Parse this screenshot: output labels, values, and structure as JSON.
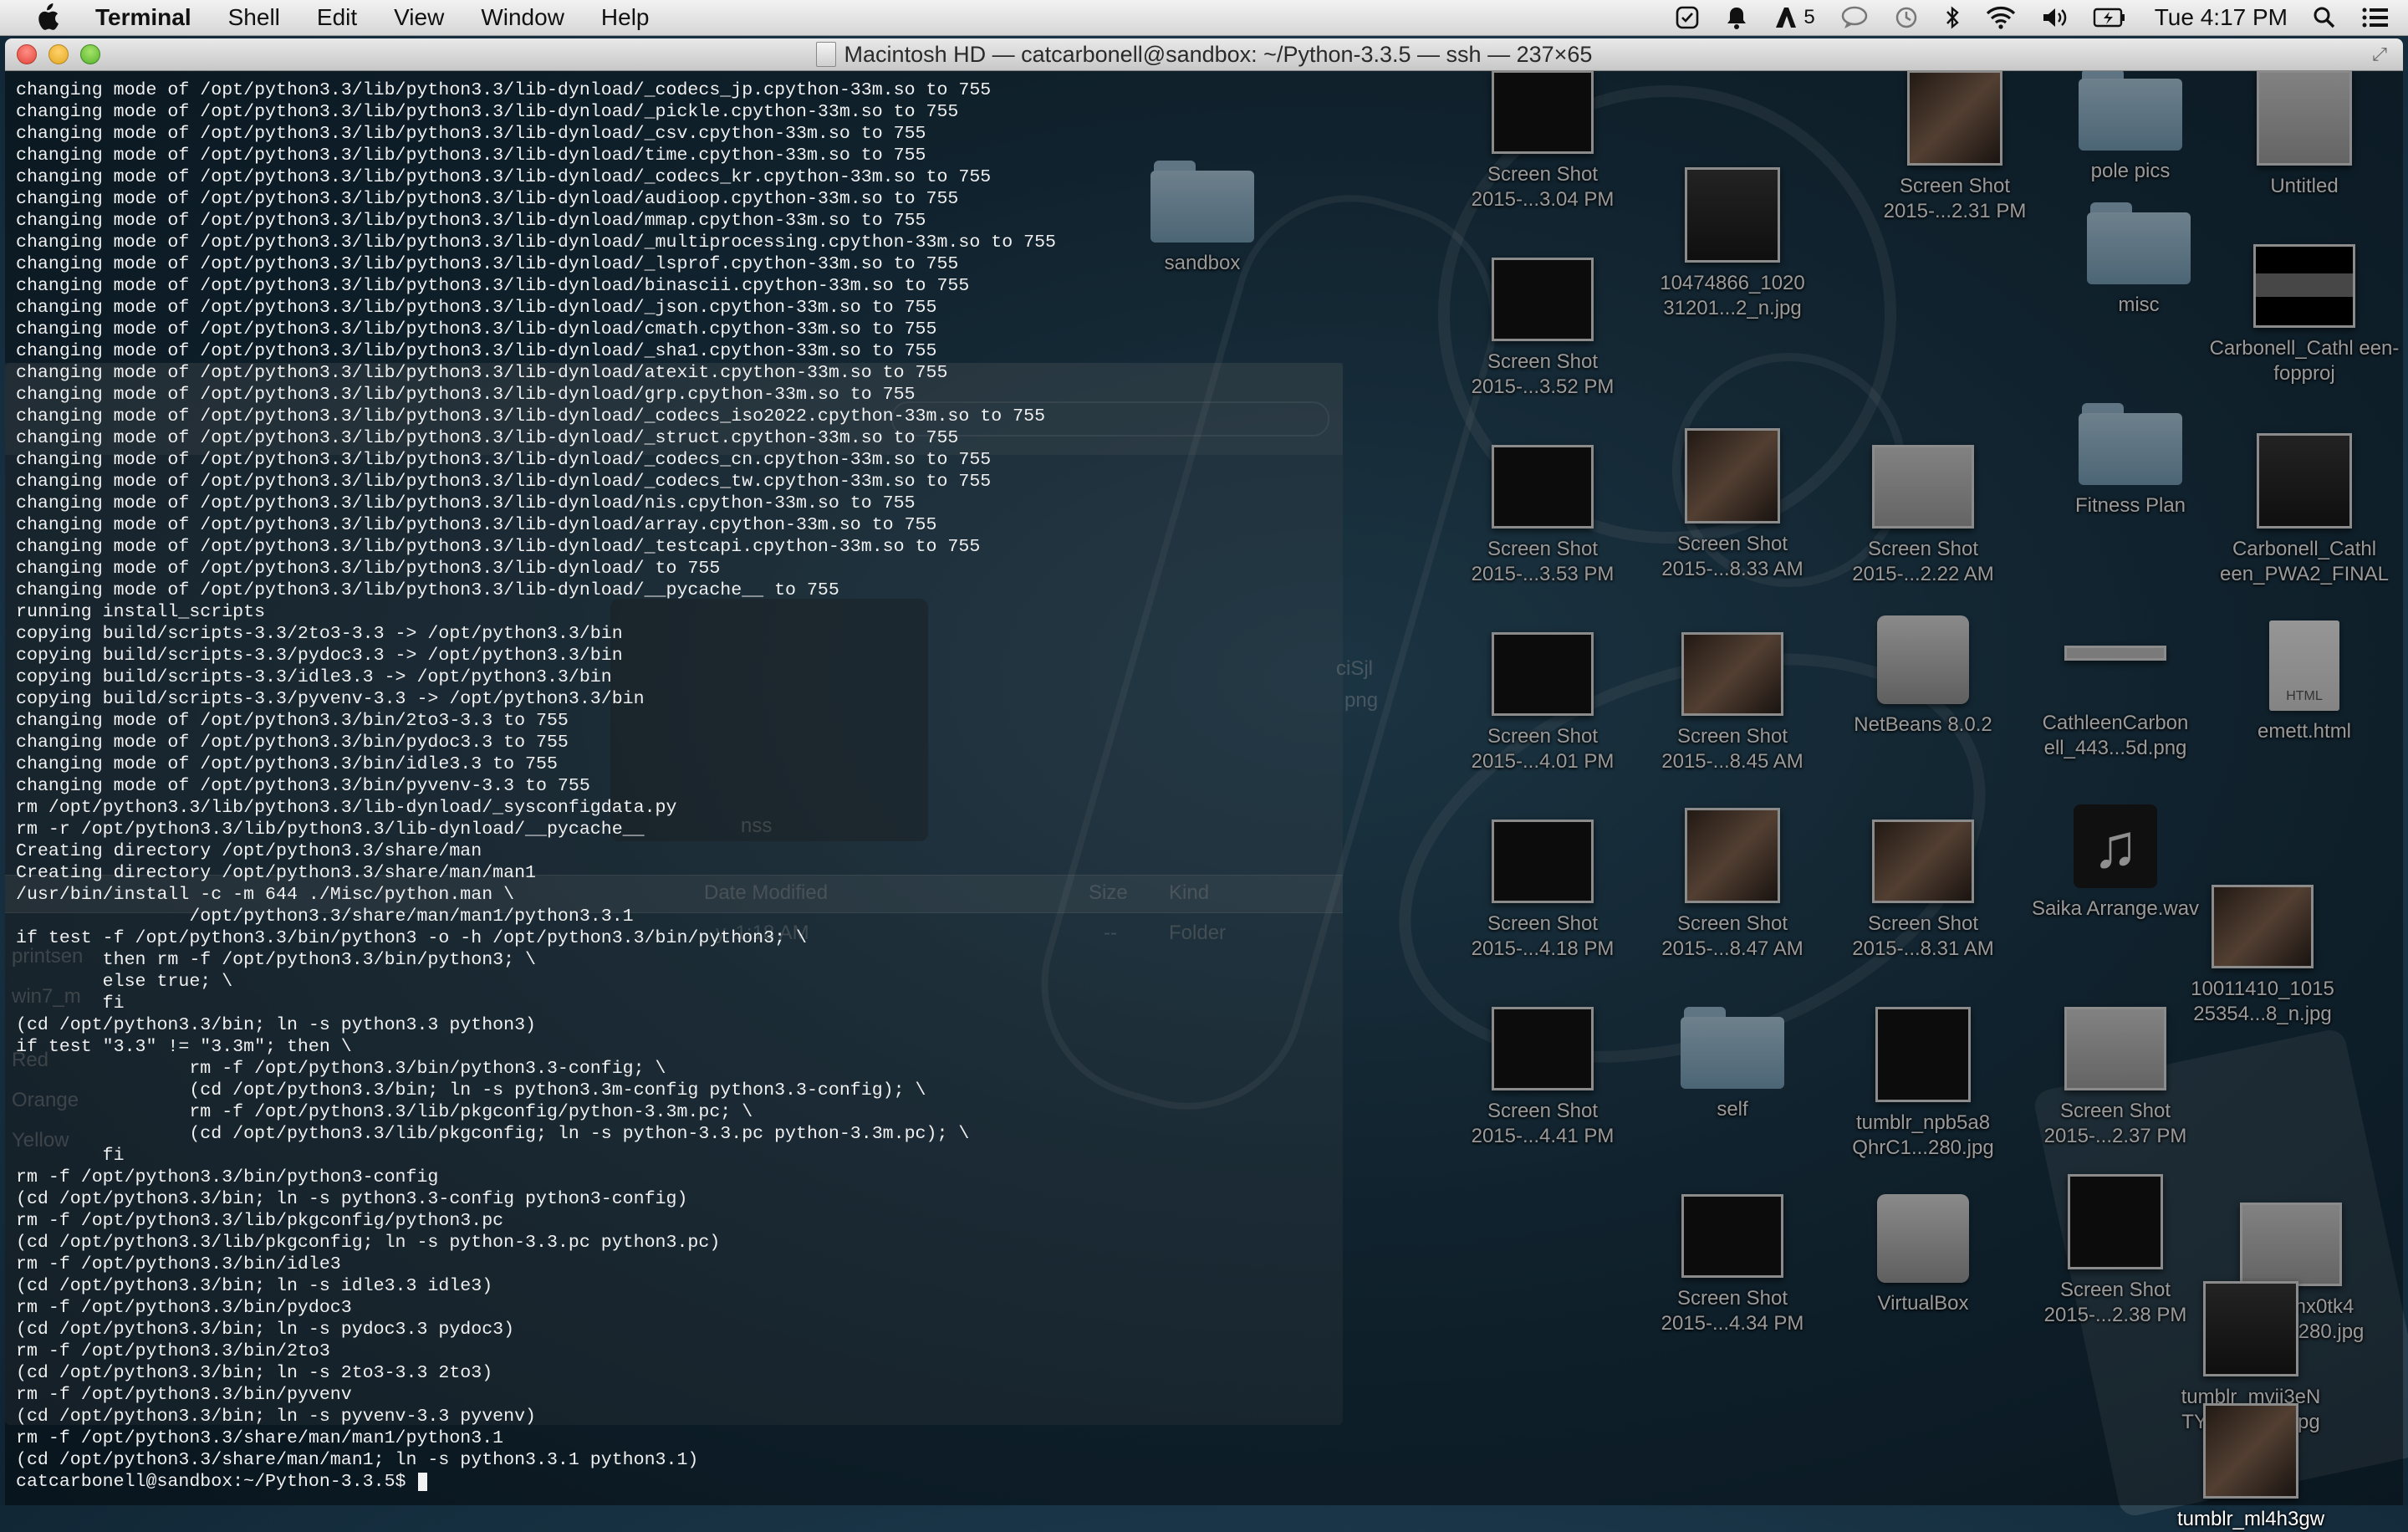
{
  "menubar": {
    "app_name": "Terminal",
    "items": [
      "Shell",
      "Edit",
      "View",
      "Window",
      "Help"
    ],
    "adobe_badge": "5",
    "clock": "Tue 4:17 PM"
  },
  "terminal": {
    "title": "Macintosh HD — catcarbonell@sandbox: ~/Python-3.3.5 — ssh — 237×65",
    "lines": [
      "changing mode of /opt/python3.3/lib/python3.3/lib-dynload/_codecs_jp.cpython-33m.so to 755",
      "changing mode of /opt/python3.3/lib/python3.3/lib-dynload/_pickle.cpython-33m.so to 755",
      "changing mode of /opt/python3.3/lib/python3.3/lib-dynload/_csv.cpython-33m.so to 755",
      "changing mode of /opt/python3.3/lib/python3.3/lib-dynload/time.cpython-33m.so to 755",
      "changing mode of /opt/python3.3/lib/python3.3/lib-dynload/_codecs_kr.cpython-33m.so to 755",
      "changing mode of /opt/python3.3/lib/python3.3/lib-dynload/audioop.cpython-33m.so to 755",
      "changing mode of /opt/python3.3/lib/python3.3/lib-dynload/mmap.cpython-33m.so to 755",
      "changing mode of /opt/python3.3/lib/python3.3/lib-dynload/_multiprocessing.cpython-33m.so to 755",
      "changing mode of /opt/python3.3/lib/python3.3/lib-dynload/_lsprof.cpython-33m.so to 755",
      "changing mode of /opt/python3.3/lib/python3.3/lib-dynload/binascii.cpython-33m.so to 755",
      "changing mode of /opt/python3.3/lib/python3.3/lib-dynload/_json.cpython-33m.so to 755",
      "changing mode of /opt/python3.3/lib/python3.3/lib-dynload/cmath.cpython-33m.so to 755",
      "changing mode of /opt/python3.3/lib/python3.3/lib-dynload/_sha1.cpython-33m.so to 755",
      "changing mode of /opt/python3.3/lib/python3.3/lib-dynload/atexit.cpython-33m.so to 755",
      "changing mode of /opt/python3.3/lib/python3.3/lib-dynload/grp.cpython-33m.so to 755",
      "changing mode of /opt/python3.3/lib/python3.3/lib-dynload/_codecs_iso2022.cpython-33m.so to 755",
      "changing mode of /opt/python3.3/lib/python3.3/lib-dynload/_struct.cpython-33m.so to 755",
      "changing mode of /opt/python3.3/lib/python3.3/lib-dynload/_codecs_cn.cpython-33m.so to 755",
      "changing mode of /opt/python3.3/lib/python3.3/lib-dynload/_codecs_tw.cpython-33m.so to 755",
      "changing mode of /opt/python3.3/lib/python3.3/lib-dynload/nis.cpython-33m.so to 755",
      "changing mode of /opt/python3.3/lib/python3.3/lib-dynload/array.cpython-33m.so to 755",
      "changing mode of /opt/python3.3/lib/python3.3/lib-dynload/_testcapi.cpython-33m.so to 755",
      "changing mode of /opt/python3.3/lib/python3.3/lib-dynload/ to 755",
      "changing mode of /opt/python3.3/lib/python3.3/lib-dynload/__pycache__ to 755",
      "running install_scripts",
      "copying build/scripts-3.3/2to3-3.3 -> /opt/python3.3/bin",
      "copying build/scripts-3.3/pydoc3.3 -> /opt/python3.3/bin",
      "copying build/scripts-3.3/idle3.3 -> /opt/python3.3/bin",
      "copying build/scripts-3.3/pyvenv-3.3 -> /opt/python3.3/bin",
      "changing mode of /opt/python3.3/bin/2to3-3.3 to 755",
      "changing mode of /opt/python3.3/bin/pydoc3.3 to 755",
      "changing mode of /opt/python3.3/bin/idle3.3 to 755",
      "changing mode of /opt/python3.3/bin/pyvenv-3.3 to 755",
      "rm /opt/python3.3/lib/python3.3/lib-dynload/_sysconfigdata.py",
      "rm -r /opt/python3.3/lib/python3.3/lib-dynload/__pycache__",
      "Creating directory /opt/python3.3/share/man",
      "Creating directory /opt/python3.3/share/man/man1",
      "/usr/bin/install -c -m 644 ./Misc/python.man \\",
      "                /opt/python3.3/share/man/man1/python3.3.1",
      "if test -f /opt/python3.3/bin/python3 -o -h /opt/python3.3/bin/python3; \\",
      "        then rm -f /opt/python3.3/bin/python3; \\",
      "        else true; \\",
      "        fi",
      "(cd /opt/python3.3/bin; ln -s python3.3 python3)",
      "if test \"3.3\" != \"3.3m\"; then \\",
      "                rm -f /opt/python3.3/bin/python3.3-config; \\",
      "                (cd /opt/python3.3/bin; ln -s python3.3m-config python3.3-config); \\",
      "                rm -f /opt/python3.3/lib/pkgconfig/python-3.3m.pc; \\",
      "                (cd /opt/python3.3/lib/pkgconfig; ln -s python-3.3.pc python-3.3m.pc); \\",
      "        fi",
      "rm -f /opt/python3.3/bin/python3-config",
      "(cd /opt/python3.3/bin; ln -s python3.3-config python3-config)",
      "rm -f /opt/python3.3/lib/pkgconfig/python3.pc",
      "(cd /opt/python3.3/lib/pkgconfig; ln -s python-3.3.pc python3.pc)",
      "rm -f /opt/python3.3/bin/idle3",
      "(cd /opt/python3.3/bin; ln -s idle3.3 idle3)",
      "rm -f /opt/python3.3/bin/pydoc3",
      "(cd /opt/python3.3/bin; ln -s pydoc3.3 pydoc3)",
      "rm -f /opt/python3.3/bin/2to3",
      "(cd /opt/python3.3/bin; ln -s 2to3-3.3 2to3)",
      "rm -f /opt/python3.3/bin/pyvenv",
      "(cd /opt/python3.3/bin; ln -s pyvenv-3.3 pyvenv)",
      "rm -f /opt/python3.3/share/man/man1/python3.1",
      "(cd /opt/python3.3/share/man/man1; ln -s python3.3.1 python3.1)"
    ],
    "prompt": "catcarbonell@sandbox:~/Python-3.3.5$ "
  },
  "finder_ghost": {
    "column_date_modified": "Date Modified",
    "column_size": "Size",
    "column_kind": "Kind",
    "row_date": "y, 1:18 AM",
    "row_size": "--",
    "row_kind": "Folder",
    "folder_name": "nss",
    "sidebar_items": [
      "printsen",
      "win7_m",
      "Red",
      "Orange",
      "Yellow"
    ],
    "partial_label_1": "ciSjl",
    "partial_label_2": "png"
  },
  "desktop": {
    "icons": [
      {
        "label": "sandbox",
        "kind": "folder"
      },
      {
        "label": "Screen Shot 2015-...3.04 PM",
        "kind": "screenshot"
      },
      {
        "label": "Screen Shot 2015-...2.31 PM",
        "kind": "photo"
      },
      {
        "label": "pole pics",
        "kind": "folder"
      },
      {
        "label": "Untitled",
        "kind": "image"
      },
      {
        "label": "10474866_1020 31201...2_n.jpg",
        "kind": "image"
      },
      {
        "label": "misc",
        "kind": "folder"
      },
      {
        "label": "Screen Shot 2015-...3.52 PM",
        "kind": "screenshot"
      },
      {
        "label": "Carbonell_Cathl een-fopproj",
        "kind": "image"
      },
      {
        "label": "Fitness Plan",
        "kind": "folder"
      },
      {
        "label": "Screen Shot 2015-...3.53 PM",
        "kind": "screenshot"
      },
      {
        "label": "Screen Shot 2015-...8.33 AM",
        "kind": "photo"
      },
      {
        "label": "Screen Shot 2015-...2.22 AM",
        "kind": "screenshot"
      },
      {
        "label": "Carbonell_Cathl een_PWA2_FINAL",
        "kind": "image"
      },
      {
        "label": "Screen Shot 2015-...4.01 PM",
        "kind": "screenshot"
      },
      {
        "label": "Screen Shot 2015-...8.45 AM",
        "kind": "photo"
      },
      {
        "label": "NetBeans 8.0.2",
        "kind": "drive"
      },
      {
        "label": "CathleenCarbon ell_443...5d.png",
        "kind": "image"
      },
      {
        "label": "emett.html",
        "kind": "file"
      },
      {
        "label": "HTML",
        "kind": "file-tag"
      },
      {
        "label": "Screen Shot 2015-...4.18 PM",
        "kind": "screenshot"
      },
      {
        "label": "Screen Shot 2015-...8.47 AM",
        "kind": "photo"
      },
      {
        "label": "Screen Shot 2015-...8.31 AM",
        "kind": "photo"
      },
      {
        "label": "Saika Arrange.wav",
        "kind": "audio"
      },
      {
        "label": "10011410_1015 25354...8_n.jpg",
        "kind": "image"
      },
      {
        "label": "Screen Shot 2015-...4.41 PM",
        "kind": "screenshot"
      },
      {
        "label": "self",
        "kind": "folder"
      },
      {
        "label": "tumblr_npb5a8 QhrC1...280.jpg",
        "kind": "image"
      },
      {
        "label": "Screen Shot 2015-...2.37 PM",
        "kind": "screenshot"
      },
      {
        "label": "Screen Shot 2015-...4.34 PM",
        "kind": "screenshot"
      },
      {
        "label": "VirtualBox",
        "kind": "drive"
      },
      {
        "label": "Screen Shot 2015-...2.38 PM",
        "kind": "screenshot"
      },
      {
        "label": "tumblr_nx0tk4 Vs1t39-1280.jpg",
        "kind": "image"
      },
      {
        "label": "tumblr_mvij3eN TYKt1...280.jpg",
        "kind": "image"
      },
      {
        "label": "tumblr_ml4h3gw",
        "kind": "image"
      }
    ]
  }
}
